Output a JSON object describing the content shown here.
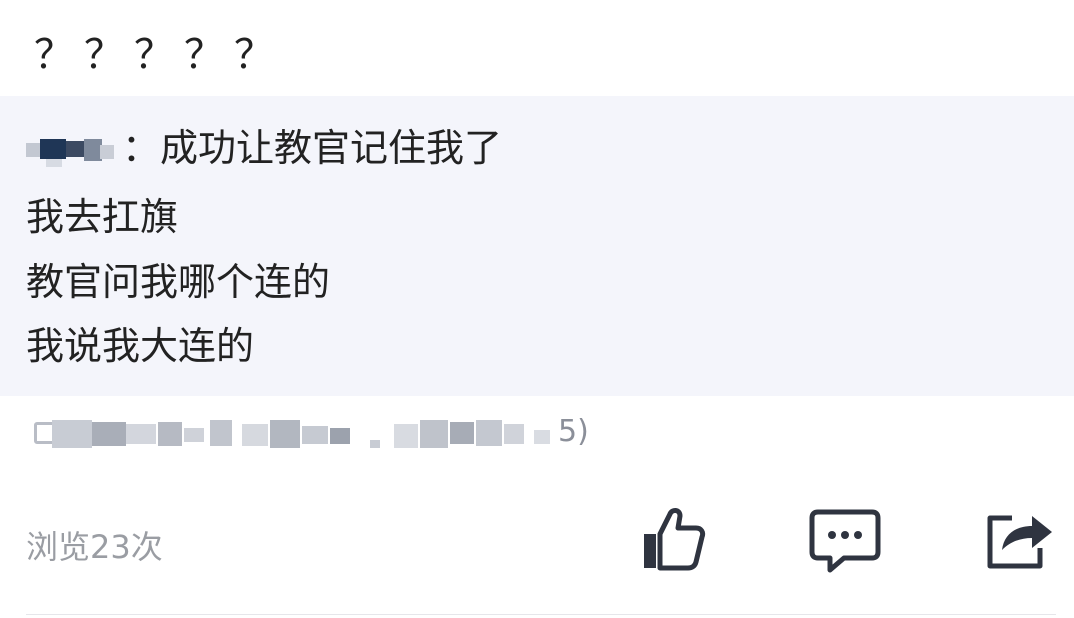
{
  "post": {
    "title": "？？？？？",
    "quote": {
      "author_suffix": "：",
      "lines": [
        "成功让教官记住我了",
        "我去扛旗",
        "教官问我哪个连的",
        "我说我大连的"
      ]
    },
    "source_tail": "5)",
    "views_text": "浏览23次"
  },
  "actions": {
    "like_icon": "thumbs-up-icon",
    "comment_icon": "comment-icon",
    "share_icon": "share-icon"
  },
  "colors": {
    "quote_background": "#f4f5fb",
    "icon_stroke": "#2f3440",
    "muted_text": "#9a9da3"
  }
}
